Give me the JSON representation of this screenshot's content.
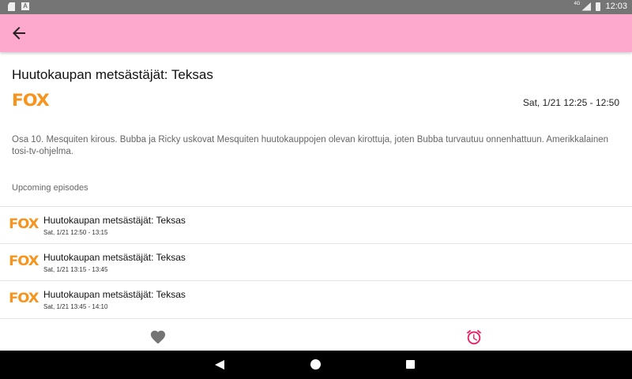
{
  "status_bar": {
    "left_icons": [
      "sd-card-icon",
      "a-notification-icon"
    ],
    "network": "4G",
    "time": "12:03"
  },
  "app_bar": {
    "back_icon": "arrow-back-icon",
    "background": "#fca9cd"
  },
  "program": {
    "title": "Huutokaupan metsästäjät: Teksas",
    "channel": "FOX",
    "airtime": "Sat, 1/21 12:25 - 12:50",
    "description": "Osa 10. Mesquiten kirous. Bubba ja Ricky uskovat Mesquiten huutokauppojen olevan kirottuja, joten Bubba turvautuu onnenhattuun. Amerikkalainen tosi-tv-ohjelma."
  },
  "upcoming": {
    "header": "Upcoming episodes",
    "episodes": [
      {
        "channel": "FOX",
        "title": "Huutokaupan metsästäjät: Teksas",
        "time": "Sat, 1/21 12:50 - 13:15"
      },
      {
        "channel": "FOX",
        "title": "Huutokaupan metsästäjät: Teksas",
        "time": "Sat, 1/21 13:15 - 13:45"
      },
      {
        "channel": "FOX",
        "title": "Huutokaupan metsästäjät: Teksas",
        "time": "Sat, 1/21 13:45 - 14:10"
      }
    ]
  },
  "actions": {
    "favorite_icon": "heart-icon",
    "reminder_icon": "alarm-clock-icon",
    "accent_color": "#e91e63"
  },
  "nav_bar": {
    "icons": [
      "nav-back-icon",
      "nav-home-icon",
      "nav-recents-icon"
    ]
  }
}
